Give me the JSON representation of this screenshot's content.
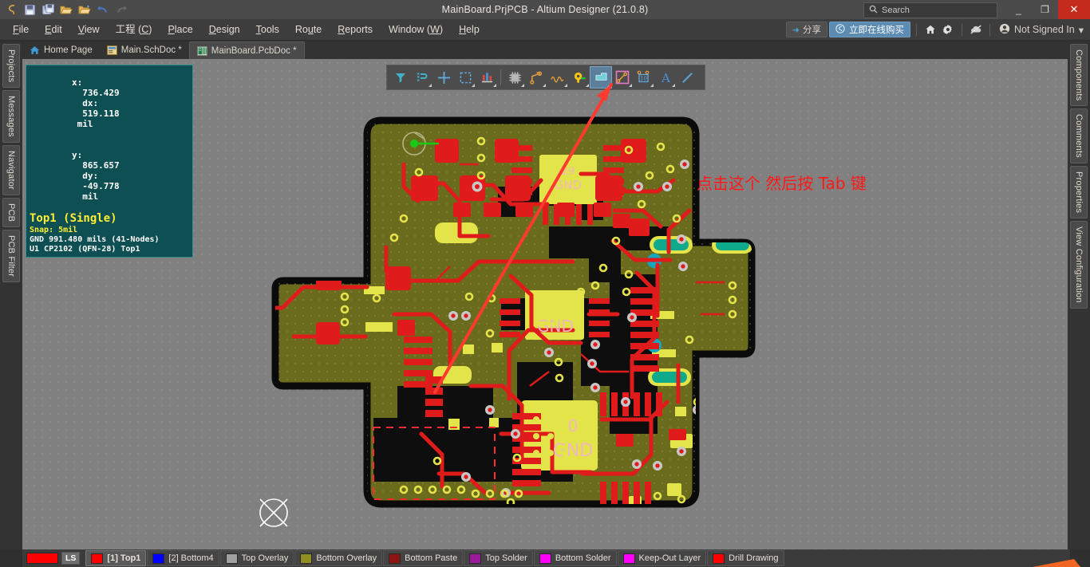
{
  "window": {
    "title": "MainBoard.PrjPCB - Altium Designer (21.0.8)",
    "minimize": "_",
    "restore": "❐",
    "close": "✕"
  },
  "search": {
    "placeholder": "Search",
    "icon": "search-icon"
  },
  "quick_access": [
    {
      "name": "altium-logo-icon",
      "glyph": "⚈"
    },
    {
      "name": "save-icon",
      "glyph": "💾"
    },
    {
      "name": "save-all-icon",
      "glyph": "💾"
    },
    {
      "name": "open-folder-icon",
      "glyph": "📂"
    },
    {
      "name": "open-project-icon",
      "glyph": "📁"
    },
    {
      "name": "undo-icon",
      "glyph": "↶"
    },
    {
      "name": "redo-icon",
      "glyph": "↷"
    }
  ],
  "menubar": {
    "items": [
      {
        "label": "File",
        "accel": "F"
      },
      {
        "label": "Edit",
        "accel": "E"
      },
      {
        "label": "View",
        "accel": "V"
      },
      {
        "label": "工程 (C)",
        "accel": "C"
      },
      {
        "label": "Place",
        "accel": "P"
      },
      {
        "label": "Design",
        "accel": "D"
      },
      {
        "label": "Tools",
        "accel": "T"
      },
      {
        "label": "Route",
        "accel": "u"
      },
      {
        "label": "Reports",
        "accel": "R"
      },
      {
        "label": "Window (W)",
        "accel": "W"
      },
      {
        "label": "Help",
        "accel": "H"
      }
    ],
    "share_label": "分享",
    "buy_label": "立即在线购买",
    "home_icon": "home-icon",
    "settings_icon": "gear-icon",
    "notconnected_icon": "no-cloud-icon",
    "account_label": "Not Signed In",
    "account_caret": "▾"
  },
  "tabs": [
    {
      "label": "Home Page",
      "icon": "home-icon",
      "active": false
    },
    {
      "label": "Main.SchDoc *",
      "icon": "schematic-doc-icon",
      "active": false
    },
    {
      "label": "MainBoard.PcbDoc *",
      "icon": "pcb-doc-icon",
      "active": true
    }
  ],
  "left_rail": [
    {
      "label": "Projects"
    },
    {
      "label": "Messages"
    },
    {
      "label": "Navigator"
    },
    {
      "label": "PCB"
    },
    {
      "label": "PCB Filter"
    }
  ],
  "right_rail": [
    {
      "label": "Components"
    },
    {
      "label": "Comments"
    },
    {
      "label": "Properties"
    },
    {
      "label": "View Configuration"
    }
  ],
  "status_overlay": {
    "x_label": "x:",
    "x_value": "736.429",
    "dx_label": "dx:",
    "dx_value": "519.118",
    "dx_unit": "mil",
    "y_label": "y:",
    "y_value": "865.657",
    "dy_label": "dy:",
    "dy_value": "-49.778",
    "dy_unit": "mil",
    "layer": "Top1 (Single)",
    "snap": "Snap: 5mil",
    "net": "GND    991.480 mils  (41-Nodes)",
    "component": "U1  CP2102 (QFN-28)  Top1"
  },
  "floating_toolbar": [
    {
      "name": "filter-icon",
      "glyph": "▼",
      "color": "#3fb0c8",
      "selected": false,
      "dropdown": false
    },
    {
      "name": "snap-magnet-icon",
      "glyph": "⌗",
      "color": "#3fb0c8",
      "selected": false,
      "dropdown": true
    },
    {
      "name": "crosshair-icon",
      "glyph": "✚",
      "color": "#5fa8dc",
      "selected": false,
      "dropdown": false
    },
    {
      "name": "select-area-icon",
      "glyph": "⬚",
      "color": "#5fa8dc",
      "selected": false,
      "dropdown": true
    },
    {
      "name": "align-icon",
      "glyph": "▃",
      "color": "#d84a3c",
      "selected": false,
      "dropdown": true
    },
    {
      "name": "place-component-icon",
      "glyph": "▦",
      "color": "#c7c7c7",
      "selected": false,
      "dropdown": true
    },
    {
      "name": "place-track-icon",
      "glyph": "↗",
      "color": "#e8a13a",
      "selected": false,
      "dropdown": true
    },
    {
      "name": "interactive-length-tuning-icon",
      "glyph": "〰",
      "color": "#e8a13a",
      "selected": false,
      "dropdown": true
    },
    {
      "name": "place-pad-icon",
      "glyph": "⚿",
      "color": "#f5c518",
      "selected": false,
      "dropdown": true
    },
    {
      "name": "place-fill-icon",
      "glyph": "◰",
      "color": "#6fd0d8",
      "selected": true,
      "dropdown": true
    },
    {
      "name": "place-dimension-icon",
      "glyph": "↗",
      "color": "#e8a13a",
      "selected": false,
      "dropdown": true
    },
    {
      "name": "place-coordinate-icon",
      "glyph": "10",
      "color": "#5fa8dc",
      "selected": false,
      "dropdown": true
    },
    {
      "name": "place-string-icon",
      "glyph": "A",
      "color": "#4a90d9",
      "selected": false,
      "dropdown": true
    },
    {
      "name": "place-line-icon",
      "glyph": "╱",
      "color": "#5fa8dc",
      "selected": false,
      "dropdown": false
    }
  ],
  "annotation": {
    "text": "点击这个 然后按 Tab 键",
    "color": "#ff1a1a"
  },
  "canvas": {
    "background": "#808080",
    "board_color": "#6b6b1e",
    "top_layer_color": "#e01b1b",
    "silk_color": "#e6e64b",
    "pad_ring_color": "#c8c8c8",
    "keepout_color": "#ff2d2d",
    "origin_marker": "origin-crosshair-circle"
  },
  "layer_bar": {
    "ls_label": "LS",
    "ls_color": "#ff0000",
    "layers": [
      {
        "label": "[1] Top1",
        "color": "#ff0000",
        "active": true
      },
      {
        "label": "[2] Bottom4",
        "color": "#0000ff",
        "active": false
      },
      {
        "label": "Top Overlay",
        "color": "#a0a0a0",
        "active": false
      },
      {
        "label": "Bottom Overlay",
        "color": "#8f8f24",
        "active": false
      },
      {
        "label": "Bottom Paste",
        "color": "#8b1414",
        "active": false
      },
      {
        "label": "Top Solder",
        "color": "#9b1a9b",
        "active": false
      },
      {
        "label": "Bottom Solder",
        "color": "#ff00ff",
        "active": false
      },
      {
        "label": "Keep-Out Layer",
        "color": "#ff00ff",
        "active": false
      },
      {
        "label": "Drill Drawing",
        "color": "#ff0000",
        "active": false
      }
    ]
  }
}
